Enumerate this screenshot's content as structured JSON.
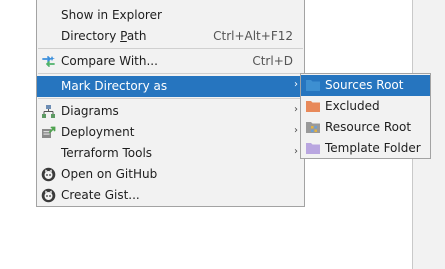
{
  "menu": {
    "show_in_explorer": "Show in Explorer",
    "directory_path": {
      "label_pre": "Directory ",
      "label_mnemonic": "P",
      "label_post": "ath",
      "shortcut": "Ctrl+Alt+F12"
    },
    "compare_with": {
      "label": "Compare With...",
      "shortcut": "Ctrl+D",
      "icon": "compare-arrows-icon"
    },
    "mark_directory_as": {
      "label": "Mark Directory as",
      "arrow": "›"
    },
    "diagrams": {
      "label": "Diagrams",
      "arrow": "›",
      "icon": "diagram-icon"
    },
    "deployment": {
      "label": "Deployment",
      "arrow": "›",
      "icon": "deployment-icon"
    },
    "terraform_tools": {
      "label": "Terraform Tools",
      "arrow": "›"
    },
    "open_on_github": {
      "label": "Open on GitHub",
      "icon": "github-icon"
    },
    "create_gist": {
      "label": "Create Gist...",
      "icon": "github-icon"
    }
  },
  "submenu": {
    "sources_root": {
      "label": "Sources Root",
      "icon": "blue-folder-icon",
      "color": "#3d8fd1"
    },
    "excluded": {
      "label": "Excluded",
      "icon": "orange-folder-icon",
      "color": "#e8895a"
    },
    "resource_root": {
      "label": "Resource Root",
      "icon": "resource-folder-icon",
      "color": "#8f8f8f"
    },
    "template_folder": {
      "label": "Template Folder",
      "icon": "purple-folder-icon",
      "color": "#b9a6e0"
    }
  },
  "colors": {
    "selection": "#2675bf",
    "menu_background": "#f2f2f2",
    "border": "#a3a3a3"
  }
}
